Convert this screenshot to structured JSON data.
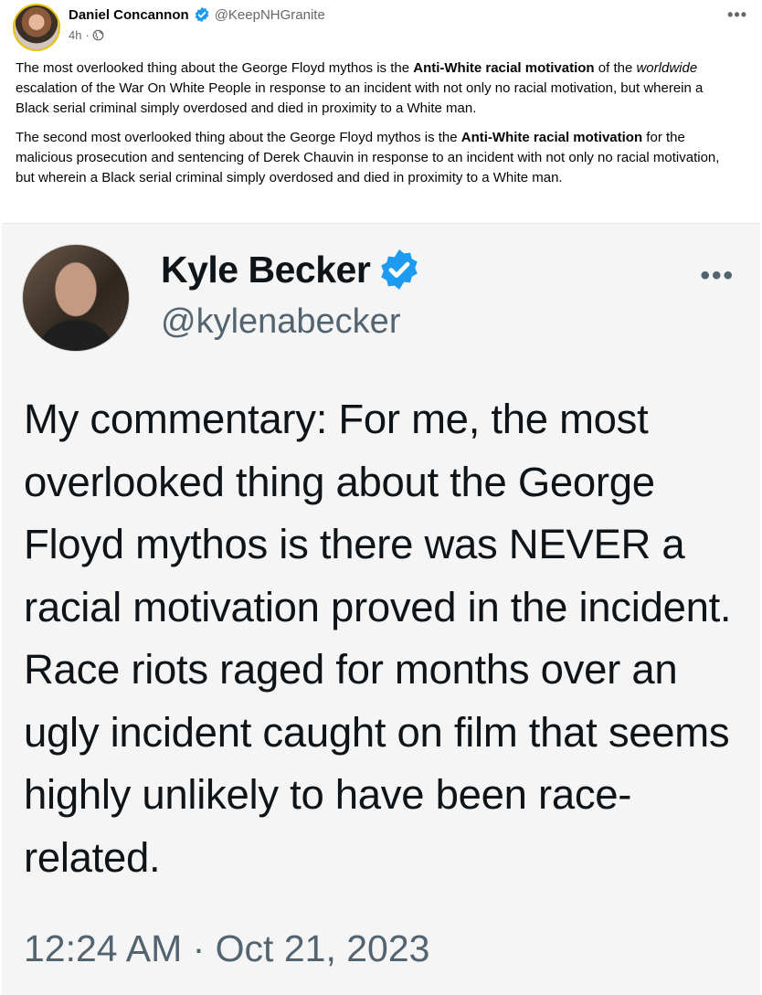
{
  "post": {
    "author": "Daniel Concannon",
    "handle": "@KeepNHGranite",
    "time": "4h",
    "separator": "·",
    "more": "•••",
    "verified_icon": "verified-badge-icon",
    "audience_icon": "globe-icon",
    "paragraph1": {
      "a": "The most overlooked thing about the George Floyd mythos is the ",
      "b": "Anti-White racial motivation",
      "c": " of the ",
      "d": "worldwide",
      "e": " escalation of the War On White People in response to an incident with not only no racial motivation, but wherein a Black serial criminal simply overdosed and died in proximity to a White man."
    },
    "paragraph2": {
      "a": "The second most overlooked thing about the George Floyd mythos is the ",
      "b": "Anti-White racial motivation",
      "c": " for the malicious prosecution and sentencing of Derek Chauvin in response to an incident with not only no racial motivation, but wherein a Black serial criminal simply overdosed and died in proximity to a White man."
    }
  },
  "tweet": {
    "name": "Kyle Becker",
    "handle": "@kylenabecker",
    "more": "•••",
    "body": "My commentary: For me, the most overlooked thing about the George Floyd mythos is there was NEVER a racial motivation proved in the incident. Race riots raged for months over an ugly incident caught on film that seems highly unlikely to have been race-related.",
    "timestamp": "12:24 AM · Oct 21, 2023"
  },
  "colors": {
    "verified_blue": "#1d9bf0",
    "text_secondary": "#65676b",
    "tweet_secondary": "#536471"
  }
}
